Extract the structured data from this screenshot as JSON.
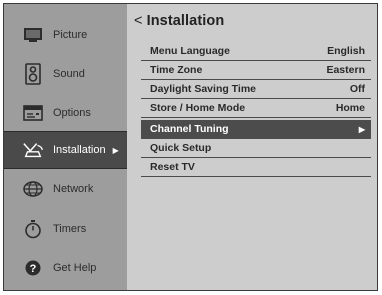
{
  "sidebar": {
    "items": [
      {
        "label": "Picture",
        "icon": "monitor-icon"
      },
      {
        "label": "Sound",
        "icon": "speaker-icon"
      },
      {
        "label": "Options",
        "icon": "options-icon"
      },
      {
        "label": "Installation",
        "icon": "antenna-icon",
        "arrow": "▶"
      },
      {
        "label": "Network",
        "icon": "globe-icon"
      },
      {
        "label": "Timers",
        "icon": "stopwatch-icon"
      },
      {
        "label": "Get Help",
        "icon": "help-icon"
      }
    ]
  },
  "header": {
    "back": "<",
    "title": "Installation"
  },
  "menu": {
    "rows": [
      {
        "label": "Menu Language",
        "value": "English"
      },
      {
        "label": "Time Zone",
        "value": "Eastern"
      },
      {
        "label": "Daylight Saving Time",
        "value": "Off"
      },
      {
        "label": "Store / Home Mode",
        "value": "Home"
      },
      {
        "label": "Channel Tuning",
        "value": "▶"
      },
      {
        "label": "Quick Setup",
        "value": ""
      },
      {
        "label": "Reset TV",
        "value": ""
      }
    ]
  },
  "colors": {
    "sidebar": "#9d9d9d",
    "selected": "#4a4a4a",
    "panel": "#cdcdcd"
  }
}
